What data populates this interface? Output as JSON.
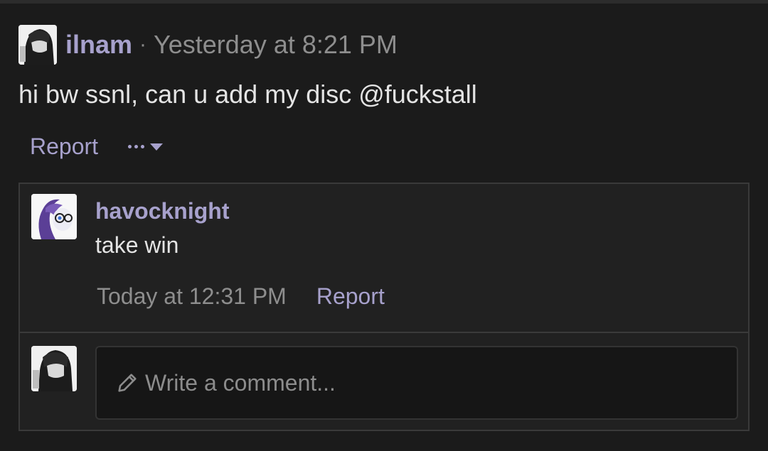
{
  "post": {
    "author": "ilnam",
    "separator": "·",
    "timestamp": "Yesterday at 8:21 PM",
    "message": "hi bw ssnl, can u add my disc @fuckstall",
    "actions": {
      "report_label": "Report",
      "more_icon": "ellipsis-icon",
      "more_caret_icon": "caret-down-icon"
    }
  },
  "comments": [
    {
      "author": "havocknight",
      "text": "take win",
      "timestamp": "Today at 12:31 PM",
      "report_label": "Report"
    }
  ],
  "reply": {
    "placeholder": "Write a comment...",
    "icon": "pencil-icon"
  },
  "colors": {
    "background": "#1b1b1b",
    "panel": "#212121",
    "accent": "#a7a1cc",
    "text": "#e4e4e4",
    "muted": "#8e8e8e"
  }
}
